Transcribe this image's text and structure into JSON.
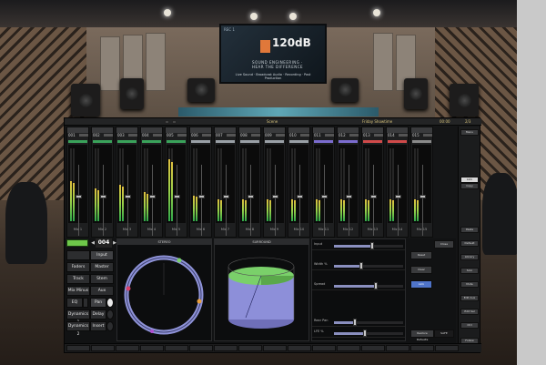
{
  "studio_screen": {
    "label": "REC 1",
    "logo": "120dB",
    "tagline": "SOUND ENGINEERING · HEAR THE DIFFERENCE",
    "services": "Live Sound · Broadcast Audio · Recording · Post Production"
  },
  "topbar": {
    "center_label": "Scene",
    "right_label": "Friday Showtime",
    "clock": "00:00",
    "right_btn": "2/3"
  },
  "strips": [
    {
      "num": "001",
      "name": "Mic 1",
      "color": "#3aa25a",
      "meter": 0.55,
      "fader": 0.55
    },
    {
      "num": "002",
      "name": "Mic 2",
      "color": "#3aa25a",
      "meter": 0.45,
      "fader": 0.55
    },
    {
      "num": "003",
      "name": "Mic 3",
      "color": "#3aa25a",
      "meter": 0.5,
      "fader": 0.55
    },
    {
      "num": "004",
      "name": "Mic 4",
      "color": "#3aa25a",
      "meter": 0.4,
      "fader": 0.55
    },
    {
      "num": "005",
      "name": "Mic 5",
      "color": "#3aa25a",
      "meter": 0.85,
      "fader": 0.55
    },
    {
      "num": "006",
      "name": "Mic 6",
      "color": "#9aa0a6",
      "meter": 0.35,
      "fader": 0.55
    },
    {
      "num": "007",
      "name": "Mic 7",
      "color": "#9aa0a6",
      "meter": 0.3,
      "fader": 0.55
    },
    {
      "num": "008",
      "name": "Mic 8",
      "color": "#9aa0a6",
      "meter": 0.3,
      "fader": 0.55
    },
    {
      "num": "009",
      "name": "Mic 9",
      "color": "#9aa0a6",
      "meter": 0.3,
      "fader": 0.55
    },
    {
      "num": "010",
      "name": "Mic 10",
      "color": "#9aa0a6",
      "meter": 0.3,
      "fader": 0.55
    },
    {
      "num": "011",
      "name": "Mic 11",
      "color": "#7b6ccf",
      "meter": 0.3,
      "fader": 0.55
    },
    {
      "num": "012",
      "name": "Mic 12",
      "color": "#7b6ccf",
      "meter": 0.3,
      "fader": 0.55
    },
    {
      "num": "013",
      "name": "Mic 13",
      "color": "#d04a4a",
      "meter": 0.3,
      "fader": 0.55
    },
    {
      "num": "014",
      "name": "Mic 14",
      "color": "#d04a4a",
      "meter": 0.3,
      "fader": 0.55
    },
    {
      "num": "015",
      "name": "Mic 15",
      "color": "#8a8a8a",
      "meter": 0.3,
      "fader": 0.55
    }
  ],
  "right_strip": {
    "buttons": [
      "Menu",
      "Link",
      "Copy",
      "Paste",
      "Default",
      "Library",
      "Solo",
      "Mute",
      "Edit Aux",
      "Edit Sel",
      "Ctrl",
      "Follow Scene"
    ]
  },
  "lower": {
    "channel_number": "004",
    "tabs": {
      "input": "Input",
      "faders": "Faders",
      "master": "Master",
      "track": "Track",
      "stem": "Stem",
      "mix_minus": "Mix Minus",
      "aux": "Aux",
      "eq": "EQ",
      "pan": "Pan",
      "dynamics1": "Dynamics 1",
      "delay": "Delay",
      "dynamics2": "Dynamics 2",
      "insert": "Insert"
    },
    "panel_left_title": "STEREO",
    "panel_mid_title": "SURROUND",
    "params": [
      {
        "label": "Input",
        "value": 0.55
      },
      {
        "label": "Width %",
        "value": 0.4
      },
      {
        "label": "Spread",
        "value": 0.6
      },
      {
        "label": "Rear Pan",
        "value": 0.3
      },
      {
        "label": "LFE %",
        "value": 0.45
      }
    ],
    "side_buttons": [
      "Reset",
      "Clear",
      "Link",
      "Restore Defaults",
      "SAFE"
    ],
    "close_label": "Close"
  }
}
